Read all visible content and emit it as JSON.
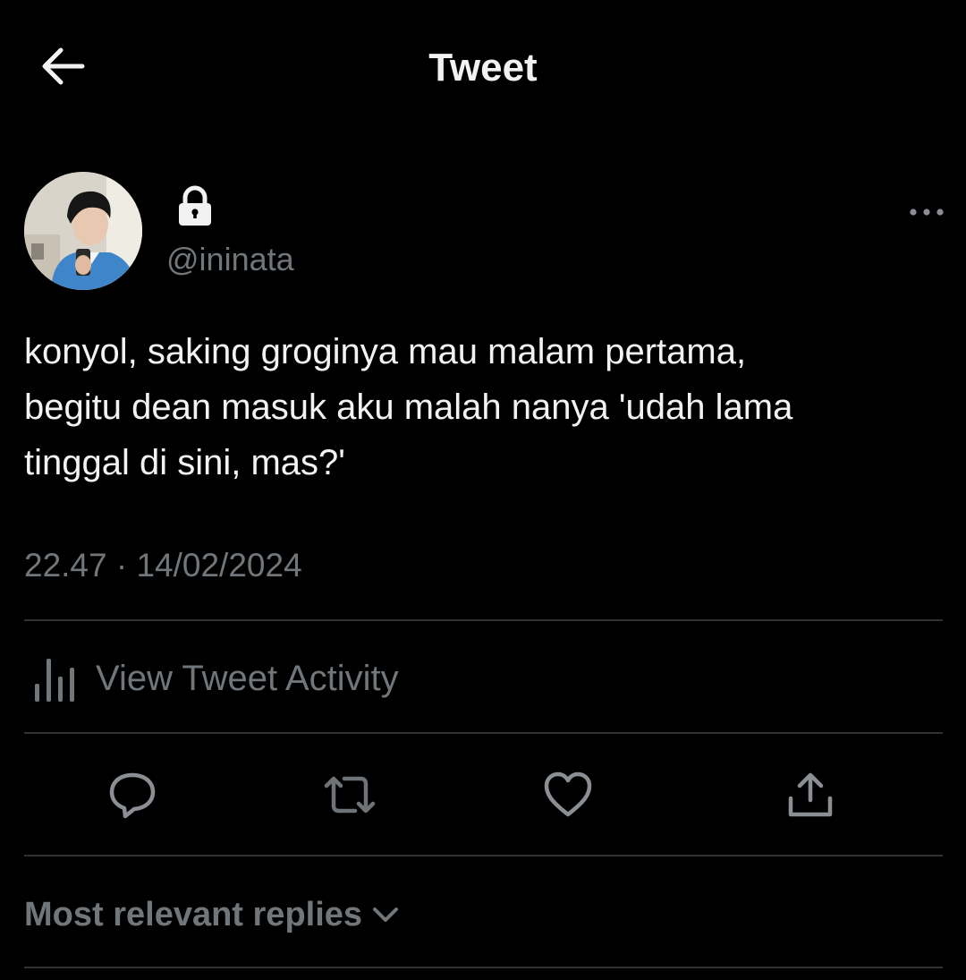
{
  "header": {
    "title": "Tweet",
    "back_icon": "arrow-left-icon"
  },
  "author": {
    "handle": "@ininata",
    "protected_icon": "lock-icon",
    "avatar": "avatar-photo"
  },
  "tweet": {
    "text": "konyol, saking groginya mau malam pertama,\nbegitu dean masuk aku malah nanya 'udah lama\ntinggal di sini, mas?'",
    "timestamp": "22.47 · 14/02/2024"
  },
  "activity": {
    "label": "View Tweet Activity",
    "icon": "bar-chart-icon"
  },
  "actions": [
    {
      "icon": "reply-icon"
    },
    {
      "icon": "retweet-icon"
    },
    {
      "icon": "heart-icon"
    },
    {
      "icon": "share-icon"
    }
  ],
  "replies": {
    "sort_label": "Most relevant replies",
    "chevron_icon": "chevron-down-icon"
  },
  "colors": {
    "background": "#000000",
    "text_primary": "#f2f2f2",
    "text_secondary": "#71767b",
    "divider": "#2f3336"
  }
}
